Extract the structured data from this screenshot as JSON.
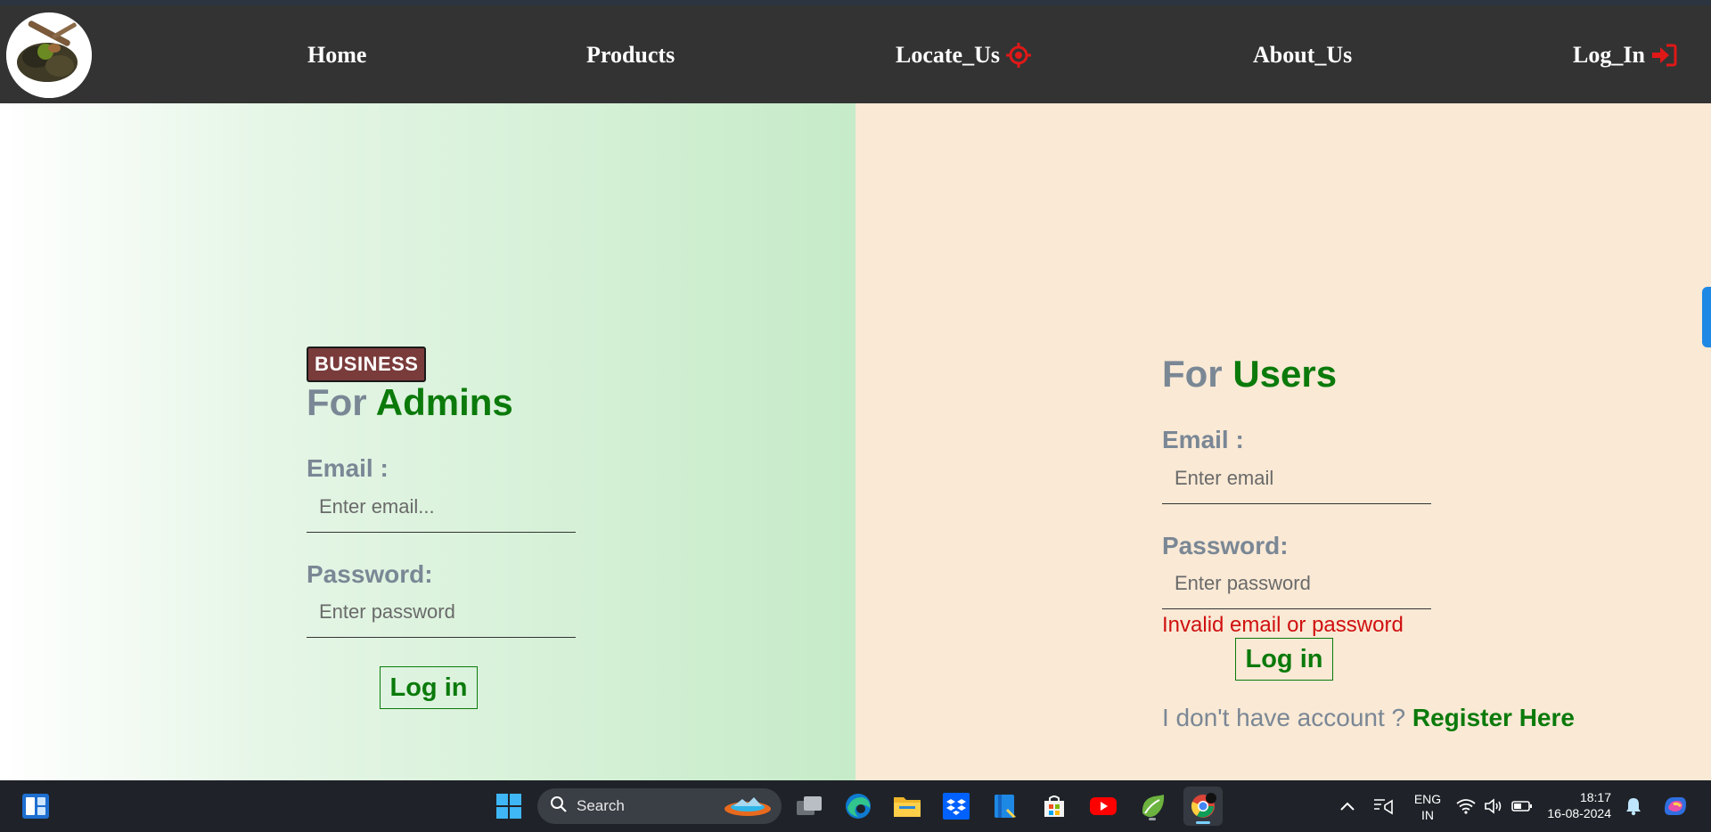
{
  "nav": {
    "home": "Home",
    "products": "Products",
    "locate": "Locate_Us",
    "about": "About_Us",
    "login": "Log_In"
  },
  "admin": {
    "badge": "BUSINESS",
    "heading_pre": "For",
    "heading_accent": "Admins",
    "email_label": "Email :",
    "email_placeholder": "Enter email...",
    "password_label": "Password:",
    "password_placeholder": "Enter password",
    "login_button": "Log in"
  },
  "user": {
    "heading_pre": "For",
    "heading_accent": "Users",
    "email_label": "Email :",
    "email_placeholder": "Enter email",
    "password_label": "Password:",
    "password_placeholder": "Enter password",
    "error": "Invalid email or password",
    "login_button": "Log in",
    "register_prefix": "I don't have account ?",
    "register_link": "Register Here"
  },
  "taskbar": {
    "search_label": "Search",
    "lang_line1": "ENG",
    "lang_line2": "IN",
    "time": "18:17",
    "date": "16-08-2024"
  },
  "colors": {
    "navbar": "#333333",
    "accent_green": "#0b7a0b",
    "muted": "#7a8795",
    "error": "#d01010",
    "badge": "#7a3b3b",
    "user_panel": "#f9e9d5"
  }
}
